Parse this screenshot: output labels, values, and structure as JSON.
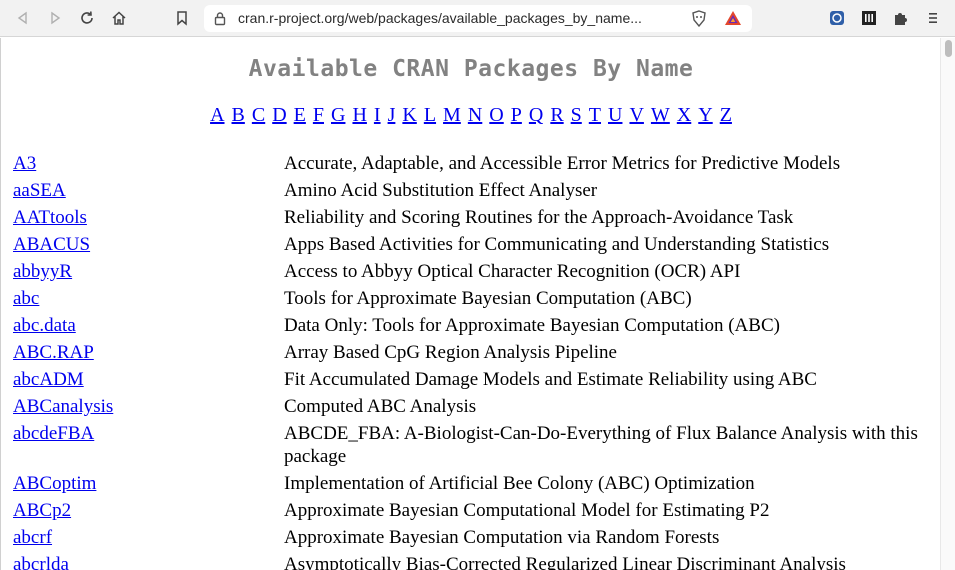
{
  "browser": {
    "url": "cran.r-project.org/web/packages/available_packages_by_name..."
  },
  "page": {
    "title": "Available CRAN Packages By Name",
    "letters": [
      "A",
      "B",
      "C",
      "D",
      "E",
      "F",
      "G",
      "H",
      "I",
      "J",
      "K",
      "L",
      "M",
      "N",
      "O",
      "P",
      "Q",
      "R",
      "S",
      "T",
      "U",
      "V",
      "W",
      "X",
      "Y",
      "Z"
    ],
    "packages": [
      {
        "name": "A3",
        "description": "Accurate, Adaptable, and Accessible Error Metrics for Predictive Models"
      },
      {
        "name": "aaSEA",
        "description": "Amino Acid Substitution Effect Analyser"
      },
      {
        "name": "AATtools",
        "description": "Reliability and Scoring Routines for the Approach-Avoidance Task"
      },
      {
        "name": "ABACUS",
        "description": "Apps Based Activities for Communicating and Understanding Statistics"
      },
      {
        "name": "abbyyR",
        "description": "Access to Abbyy Optical Character Recognition (OCR) API"
      },
      {
        "name": "abc",
        "description": "Tools for Approximate Bayesian Computation (ABC)"
      },
      {
        "name": "abc.data",
        "description": "Data Only: Tools for Approximate Bayesian Computation (ABC)"
      },
      {
        "name": "ABC.RAP",
        "description": "Array Based CpG Region Analysis Pipeline"
      },
      {
        "name": "abcADM",
        "description": "Fit Accumulated Damage Models and Estimate Reliability using ABC"
      },
      {
        "name": "ABCanalysis",
        "description": "Computed ABC Analysis"
      },
      {
        "name": "abcdeFBA",
        "description": "ABCDE_FBA: A-Biologist-Can-Do-Everything of Flux Balance Analysis with this package"
      },
      {
        "name": "ABCoptim",
        "description": "Implementation of Artificial Bee Colony (ABC) Optimization"
      },
      {
        "name": "ABCp2",
        "description": "Approximate Bayesian Computational Model for Estimating P2"
      },
      {
        "name": "abcrf",
        "description": "Approximate Bayesian Computation via Random Forests"
      },
      {
        "name": "abcrlda",
        "description": "Asymptotically Bias-Corrected Regularized Linear Discriminant Analysis"
      }
    ]
  },
  "icons": {
    "back": "back-arrow-icon",
    "forward": "forward-arrow-icon",
    "reload": "reload-icon",
    "home": "home-icon",
    "bookmark": "bookmark-icon",
    "lock": "lock-icon",
    "brave": "brave-shield-icon",
    "rewards": "brave-rewards-icon",
    "ext1": "extension-blue-icon",
    "ext2": "extension-library-icon",
    "extensions": "puzzle-icon",
    "menu": "menu-icon"
  },
  "colors": {
    "link": "#0000ee",
    "title": "#828282"
  }
}
